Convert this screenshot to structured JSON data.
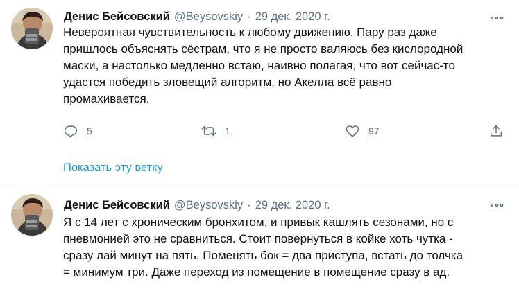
{
  "tweets": [
    {
      "author_name": "Денис Бейсовский",
      "author_handle": "@Beysovskiy",
      "separator": "·",
      "date": "29 дек. 2020 г.",
      "text": "Невероятная чувствительность к любому движению. Пару раз даже\nпришлось объяснять сёстрам, что я не просто валяюсь без кислородной\nмаски, а настолько медленно встаю, наивно полагая, что вот сейчас-то\nудастся победить зловещий алгоритм, но Акелла всё равно\nпромахивается.",
      "actions": {
        "reply_count": "5",
        "retweet_count": "1",
        "like_count": "97"
      },
      "show_thread_label": "Показать эту ветку"
    },
    {
      "author_name": "Денис Бейсовский",
      "author_handle": "@Beysovskiy",
      "separator": "·",
      "date": "29 дек. 2020 г.",
      "text": "Я с 14 лет с хроническим бронхитом, и привык кашлять сезонами, но с\nпневмонией это не сравниться. Стоит повернуться в койке хоть чутка -\nсразу лай минут на пять. Поменять бок = два приступа, встать до толчка\n= минимум три. Даже переход из помещение в помещение сразу в ад."
    }
  ],
  "icons": {
    "reply": "reply-icon",
    "retweet": "retweet-icon",
    "like": "heart-icon",
    "share": "share-icon",
    "more": "more-icon",
    "avatar": "avatar-photo"
  },
  "colors": {
    "text": "#0f1419",
    "secondary": "#5b7083",
    "link": "#1b95e0",
    "divider": "#e6ecf0"
  }
}
